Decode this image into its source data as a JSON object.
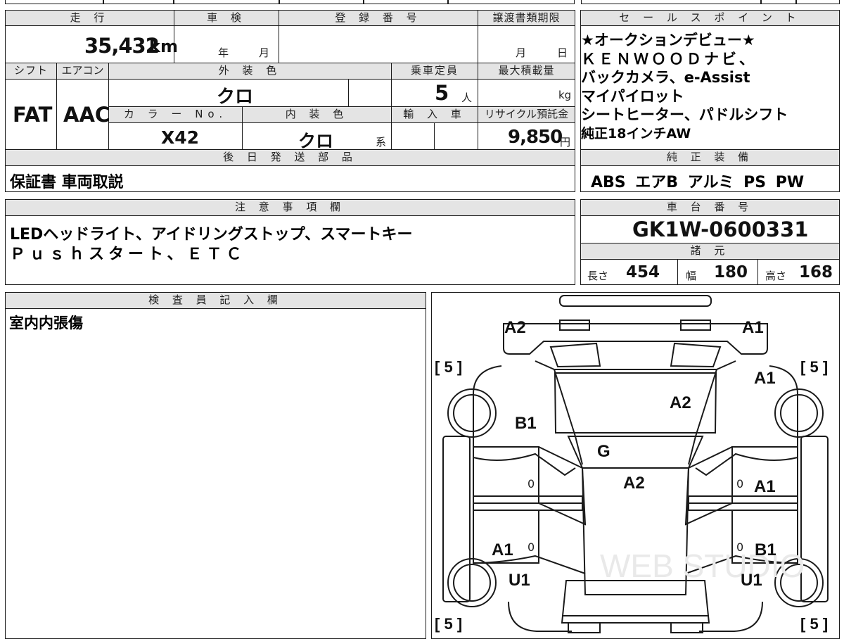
{
  "mileage": {
    "header": "走 行",
    "value": "35,432",
    "unit": "km"
  },
  "inspection": {
    "header": "車 検",
    "year_label": "年",
    "month_label": "月"
  },
  "registration": {
    "header": "登 録 番 号"
  },
  "transfer": {
    "header": "譲渡書類期限",
    "month_label": "月",
    "day_label": "日"
  },
  "shift": {
    "header": "シフト",
    "value": "FAT"
  },
  "aircon": {
    "header": "エアコン",
    "value": "AAC"
  },
  "exterior": {
    "header": "外 装 色",
    "value": "クロ"
  },
  "capacity": {
    "header": "乗車定員",
    "value": "5",
    "unit": "人"
  },
  "max_load": {
    "header": "最大積載量",
    "unit": "kg"
  },
  "color_no": {
    "header": "カ ラ ー No.",
    "value": "X42"
  },
  "interior": {
    "header": "内 装 色",
    "value": "クロ",
    "suffix": "系"
  },
  "import": {
    "header": "輸 入 車"
  },
  "recycle": {
    "header": "リサイクル預託金",
    "value": "9,850",
    "unit": "円"
  },
  "later_parts": {
    "header": "後 日 発 送 部 品",
    "value": "保証書 車両取説"
  },
  "sales_points": {
    "header": "セ ー ル ス ポ イ ン ト",
    "lines": [
      "★オークションデビュー★",
      "ＫＥＮＷＯＯＤナビ、",
      "バックカメラ、e-Assist",
      "マイパイロット",
      "シートヒーター、パドルシフト",
      "純正18インチAW"
    ]
  },
  "equipment": {
    "header": "純 正 装 備",
    "value": "ABS エアB アルミ PS PW"
  },
  "notes": {
    "header": "注 意 事 項 欄",
    "lines": [
      "LEDヘッドライト、アイドリングストップ、スマートキー",
      "Ｐｕｓｈスタート、ＥＴＣ"
    ]
  },
  "chassis": {
    "header": "車 台 番 号",
    "value": "GK1W-0600331"
  },
  "specs": {
    "header": "諸 元",
    "length_label": "長さ",
    "length": "454",
    "width_label": "幅",
    "width": "180",
    "height_label": "高さ",
    "height": "168"
  },
  "inspector": {
    "header": "検 査 員 記 入 欄",
    "value": "室内内張傷"
  },
  "diagram": {
    "labels": {
      "front_left_bumper": "A2",
      "front_right_bumper": "A1",
      "right_front_fender": "A1",
      "hood": "A2",
      "left_front_fender": "B1",
      "windshield": "G",
      "roof": "A2",
      "right_front_door": "A1",
      "left_rear_door": "A1",
      "right_rear_door": "B1",
      "left_rear_wheel": "U1",
      "right_rear_wheel": "U1"
    },
    "tires": {
      "fl": "5",
      "fr": "5",
      "rl": "5",
      "rr": "5"
    },
    "zeros": [
      "0",
      "0",
      "0",
      "0"
    ],
    "watermark": "WEB STUDIO"
  }
}
